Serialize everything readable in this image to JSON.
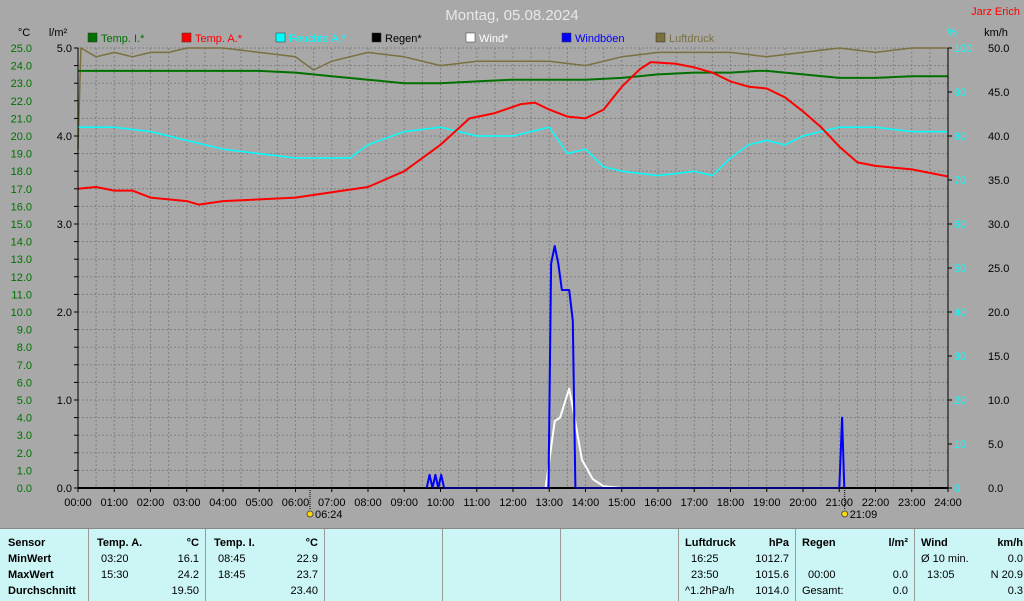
{
  "title": "Montag, 05.08.2024",
  "brand": "Jarz Erich",
  "colors": {
    "temp_i": "#007000",
    "temp_a": "#ff0000",
    "humidity": "#00ffff",
    "rain": "#000000",
    "wind": "#ffffff",
    "gusts": "#0000ff",
    "pressure": "#7a7040",
    "grid": "#808080",
    "bg": "#a8a8a8",
    "table_bg": "#ccf5f5"
  },
  "axes": {
    "left_temp_unit": "°C",
    "left_rain_unit": "l/m²",
    "right_pct_unit": "%",
    "right_kmh_unit": "km/h",
    "temp_ticks": [
      "25.0",
      "24.0",
      "23.0",
      "22.0",
      "21.0",
      "20.0",
      "19.0",
      "18.0",
      "17.0",
      "16.0",
      "15.0",
      "14.0",
      "13.0",
      "12.0",
      "11.0",
      "10.0",
      "9.0",
      "8.0",
      "7.0",
      "6.0",
      "5.0",
      "4.0",
      "3.0",
      "2.0",
      "1.0",
      "0.0"
    ],
    "rain_ticks": [
      "5.0",
      "4.0",
      "3.0",
      "2.0",
      "1.0",
      "0.0"
    ],
    "pct_ticks": [
      "100",
      "90",
      "80",
      "70",
      "60",
      "50",
      "40",
      "30",
      "20",
      "10",
      "0"
    ],
    "kmh_ticks": [
      "50.0",
      "45.0",
      "40.0",
      "35.0",
      "30.0",
      "25.0",
      "20.0",
      "15.0",
      "10.0",
      "5.0",
      "0.0"
    ],
    "x_ticks": [
      "00:00",
      "01:00",
      "02:00",
      "03:00",
      "04:00",
      "05:00",
      "06:00",
      "07:00",
      "08:00",
      "09:00",
      "10:00",
      "11:00",
      "12:00",
      "13:00",
      "14:00",
      "15:00",
      "16:00",
      "17:00",
      "18:00",
      "19:00",
      "20:00",
      "21:00",
      "22:00",
      "23:00",
      "24:00"
    ],
    "sunrise": "06:24",
    "sunset": "21:09"
  },
  "chart_data": {
    "type": "line",
    "title": "Montag, 05.08.2024",
    "x_unit": "hour",
    "ylim_temp": [
      0,
      25
    ],
    "ylim_rain": [
      0,
      5
    ],
    "ylim_pct": [
      0,
      100
    ],
    "ylim_kmh": [
      0,
      50
    ],
    "grid": true,
    "legend": "top",
    "series": [
      {
        "name": "Temp. I.*",
        "key": "temp_i",
        "axis": "temp",
        "points": [
          [
            0,
            23.7
          ],
          [
            3,
            23.7
          ],
          [
            4,
            23.7
          ],
          [
            5,
            23.7
          ],
          [
            6,
            23.6
          ],
          [
            7,
            23.4
          ],
          [
            8,
            23.2
          ],
          [
            9,
            23.0
          ],
          [
            10,
            23.0
          ],
          [
            11,
            23.1
          ],
          [
            12,
            23.2
          ],
          [
            13,
            23.2
          ],
          [
            14,
            23.2
          ],
          [
            15,
            23.3
          ],
          [
            16,
            23.5
          ],
          [
            17,
            23.6
          ],
          [
            18,
            23.6
          ],
          [
            18.75,
            23.7
          ],
          [
            19,
            23.7
          ],
          [
            20,
            23.5
          ],
          [
            21,
            23.3
          ],
          [
            22,
            23.3
          ],
          [
            23,
            23.4
          ],
          [
            24,
            23.4
          ]
        ]
      },
      {
        "name": "Temp. A.*",
        "key": "temp_a",
        "axis": "temp",
        "points": [
          [
            0,
            17.0
          ],
          [
            0.5,
            17.1
          ],
          [
            1,
            16.9
          ],
          [
            1.5,
            16.9
          ],
          [
            2,
            16.5
          ],
          [
            3,
            16.3
          ],
          [
            3.33,
            16.1
          ],
          [
            4,
            16.3
          ],
          [
            5,
            16.4
          ],
          [
            6,
            16.5
          ],
          [
            7,
            16.8
          ],
          [
            8,
            17.1
          ],
          [
            9,
            18.0
          ],
          [
            10,
            19.5
          ],
          [
            10.8,
            21.0
          ],
          [
            11.5,
            21.3
          ],
          [
            12.2,
            21.8
          ],
          [
            12.6,
            21.9
          ],
          [
            13,
            21.5
          ],
          [
            13.5,
            21.1
          ],
          [
            14,
            21.0
          ],
          [
            14.5,
            21.5
          ],
          [
            15,
            22.8
          ],
          [
            15.5,
            23.8
          ],
          [
            15.8,
            24.2
          ],
          [
            16.5,
            24.1
          ],
          [
            17,
            23.9
          ],
          [
            17.5,
            23.6
          ],
          [
            18,
            23.1
          ],
          [
            18.5,
            22.8
          ],
          [
            19,
            22.7
          ],
          [
            19.5,
            22.2
          ],
          [
            20,
            21.4
          ],
          [
            20.5,
            20.5
          ],
          [
            21,
            19.4
          ],
          [
            21.5,
            18.5
          ],
          [
            22,
            18.3
          ],
          [
            23,
            18.1
          ],
          [
            24,
            17.7
          ]
        ]
      },
      {
        "name": "Feuchte A.*",
        "key": "humidity",
        "axis": "pct",
        "points": [
          [
            0,
            82
          ],
          [
            1,
            82
          ],
          [
            2,
            81
          ],
          [
            3,
            79
          ],
          [
            4,
            77
          ],
          [
            5,
            76
          ],
          [
            6,
            75
          ],
          [
            7,
            75
          ],
          [
            7.5,
            75
          ],
          [
            8,
            78
          ],
          [
            9,
            81
          ],
          [
            10,
            82
          ],
          [
            11,
            80
          ],
          [
            12,
            80
          ],
          [
            13,
            82
          ],
          [
            13.5,
            76
          ],
          [
            14,
            77
          ],
          [
            14.5,
            73
          ],
          [
            15,
            72
          ],
          [
            16,
            71
          ],
          [
            17,
            72
          ],
          [
            17.5,
            71
          ],
          [
            18,
            75
          ],
          [
            18.5,
            78
          ],
          [
            19,
            79
          ],
          [
            19.5,
            78
          ],
          [
            20,
            80
          ],
          [
            21,
            82
          ],
          [
            22,
            82
          ],
          [
            23,
            81
          ],
          [
            24,
            81
          ]
        ]
      },
      {
        "name": "Regen*",
        "key": "rain",
        "axis": "rain",
        "points": [
          [
            0,
            0
          ],
          [
            24,
            0
          ]
        ]
      },
      {
        "name": "Wind*",
        "key": "wind",
        "axis": "kmh",
        "points": [
          [
            12.9,
            0
          ],
          [
            13.15,
            7.6
          ],
          [
            13.3,
            8.0
          ],
          [
            13.45,
            10.0
          ],
          [
            13.55,
            11.3
          ],
          [
            13.7,
            8.0
          ],
          [
            13.9,
            3.2
          ],
          [
            14.2,
            1.0
          ],
          [
            14.5,
            0.2
          ],
          [
            15,
            0
          ]
        ]
      },
      {
        "name": "Windböen",
        "key": "gusts",
        "axis": "kmh",
        "points": [
          [
            9.62,
            0
          ],
          [
            9.7,
            1.5
          ],
          [
            9.78,
            0
          ],
          [
            9.86,
            1.5
          ],
          [
            9.94,
            0
          ],
          [
            10.02,
            1.5
          ],
          [
            10.1,
            0
          ],
          [
            12.98,
            0
          ],
          [
            13.05,
            25.5
          ],
          [
            13.15,
            27.5
          ],
          [
            13.25,
            25.5
          ],
          [
            13.35,
            22.5
          ],
          [
            13.55,
            22.5
          ],
          [
            13.65,
            19.0
          ],
          [
            13.72,
            0
          ],
          [
            21.0,
            0
          ],
          [
            21.08,
            8.0
          ],
          [
            21.14,
            0
          ]
        ]
      },
      {
        "name": "Luftdruck",
        "key": "pressure",
        "axis": "pct",
        "points": [
          [
            0,
            77
          ],
          [
            0.08,
            100
          ],
          [
            0.5,
            98
          ],
          [
            1,
            99
          ],
          [
            1.5,
            98
          ],
          [
            2,
            99
          ],
          [
            2.5,
            99
          ],
          [
            3,
            100
          ],
          [
            4,
            100
          ],
          [
            5,
            99
          ],
          [
            6,
            98
          ],
          [
            6.5,
            95
          ],
          [
            7,
            97
          ],
          [
            8,
            99
          ],
          [
            9,
            98
          ],
          [
            10,
            96
          ],
          [
            11,
            97
          ],
          [
            12,
            97
          ],
          [
            13,
            97
          ],
          [
            14,
            96
          ],
          [
            15,
            98
          ],
          [
            16,
            99
          ],
          [
            17,
            99
          ],
          [
            18,
            99
          ],
          [
            19,
            98
          ],
          [
            20,
            99
          ],
          [
            21,
            100
          ],
          [
            22,
            99
          ],
          [
            23,
            100
          ],
          [
            24,
            100
          ]
        ]
      }
    ]
  },
  "table": {
    "row_labels": [
      "Sensor",
      "MinWert",
      "MaxWert",
      "Durchschnitt"
    ],
    "temp_a": {
      "header": "Temp. A.",
      "unit": "°C",
      "min_time": "03:20",
      "min_val": "16.1",
      "max_time": "15:30",
      "max_val": "24.2",
      "avg": "19.50"
    },
    "temp_i": {
      "header": "Temp. I.",
      "unit": "°C",
      "min_time": "08:45",
      "min_val": "22.9",
      "max_time": "18:45",
      "max_val": "23.7",
      "avg": "23.40"
    },
    "pressure": {
      "header": "Luftdruck",
      "unit": "hPa",
      "min_time": "16:25",
      "min_val": "1012.7",
      "max_time": "23:50",
      "max_val": "1015.6",
      "trend_label": "^1.2hPa/h",
      "trend_val": "1014.0"
    },
    "rain": {
      "header": "Regen",
      "unit": "l/m²",
      "time": "00:00",
      "val": "0.0",
      "total_label": "Gesamt:",
      "total_val": "0.0"
    },
    "wind": {
      "header": "Wind",
      "unit": "km/h",
      "avg_label": "Ø 10 min.",
      "avg_val": "0.0",
      "max_time": "13:05",
      "max_val": "N 20.9",
      "last_val": "0.3"
    }
  }
}
